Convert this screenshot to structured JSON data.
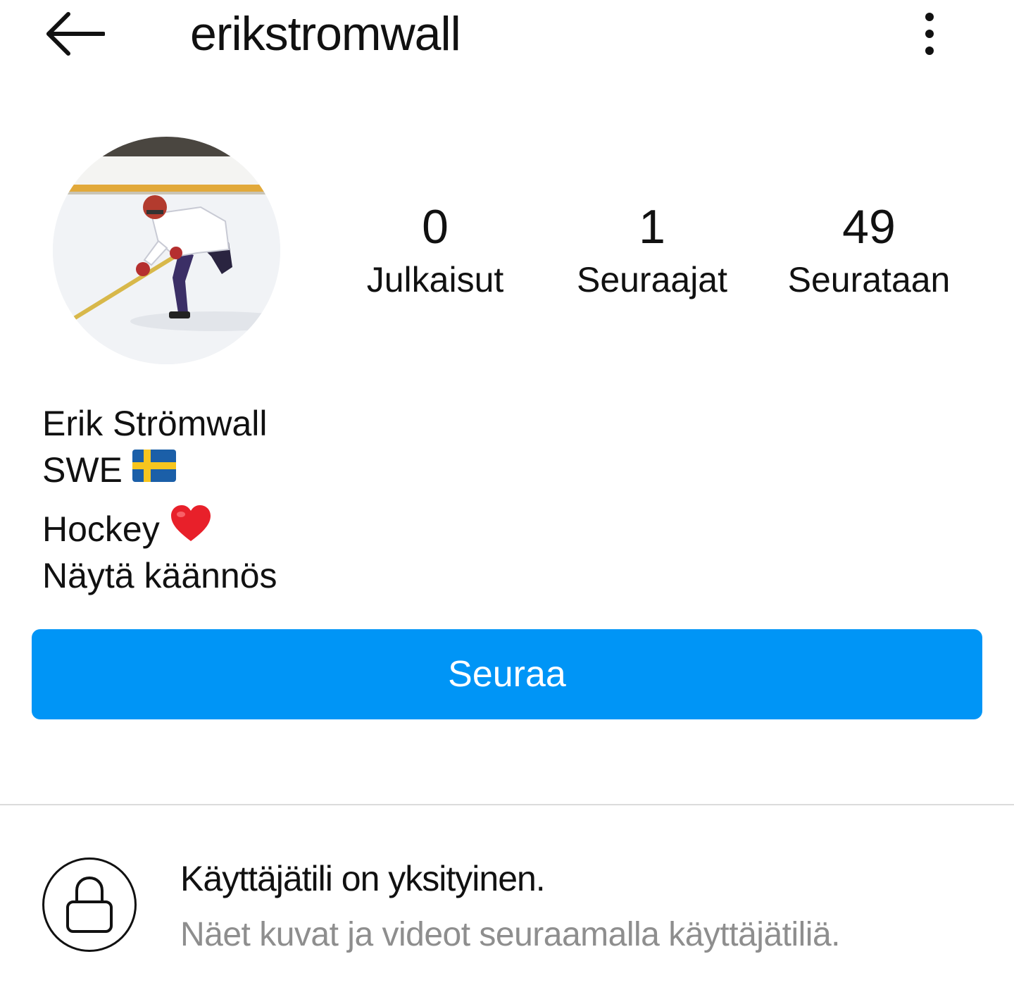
{
  "header": {
    "back_icon": "arrow-left-icon",
    "username": "erikstromwall",
    "more_icon": "vertical-dots-icon"
  },
  "profile": {
    "avatar_description": "hockey-player-photo",
    "stats": [
      {
        "value": "0",
        "label": "Julkaisut"
      },
      {
        "value": "1",
        "label": "Seuraajat"
      },
      {
        "value": "49",
        "label": "Seurataan"
      }
    ]
  },
  "bio": {
    "name": "Erik Strömwall",
    "country": "SWE",
    "country_flag": "🇸🇪",
    "sport": "Hockey",
    "sport_emoji": "❤️",
    "translate_link": "Näytä käännös"
  },
  "follow_button": {
    "label": "Seuraa",
    "color": "#0095f6"
  },
  "private_notice": {
    "icon": "lock-icon",
    "title": "Käyttäjätili on yksityinen.",
    "subtitle": "Näet kuvat ja videot seuraamalla käyttäjätiliä."
  }
}
